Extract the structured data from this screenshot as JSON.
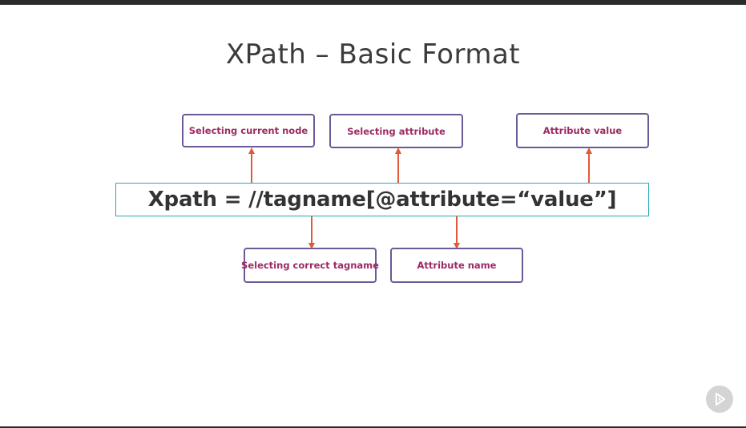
{
  "title": "XPath – Basic Format",
  "formula": "Xpath = //tagname[@attribute=“value”]",
  "labels": {
    "current_node": "Selecting current node",
    "attribute": "Selecting attribute",
    "attribute_value": "Attribute value",
    "tagname": "Selecting correct tagname",
    "attribute_name": "Attribute name"
  },
  "colors": {
    "box_border": "#6b5a97",
    "label_text": "#9c2a64",
    "formula_border": "#2aa8b8",
    "arrow": "#e05a3a"
  },
  "icons": {
    "player": "play-icon"
  }
}
